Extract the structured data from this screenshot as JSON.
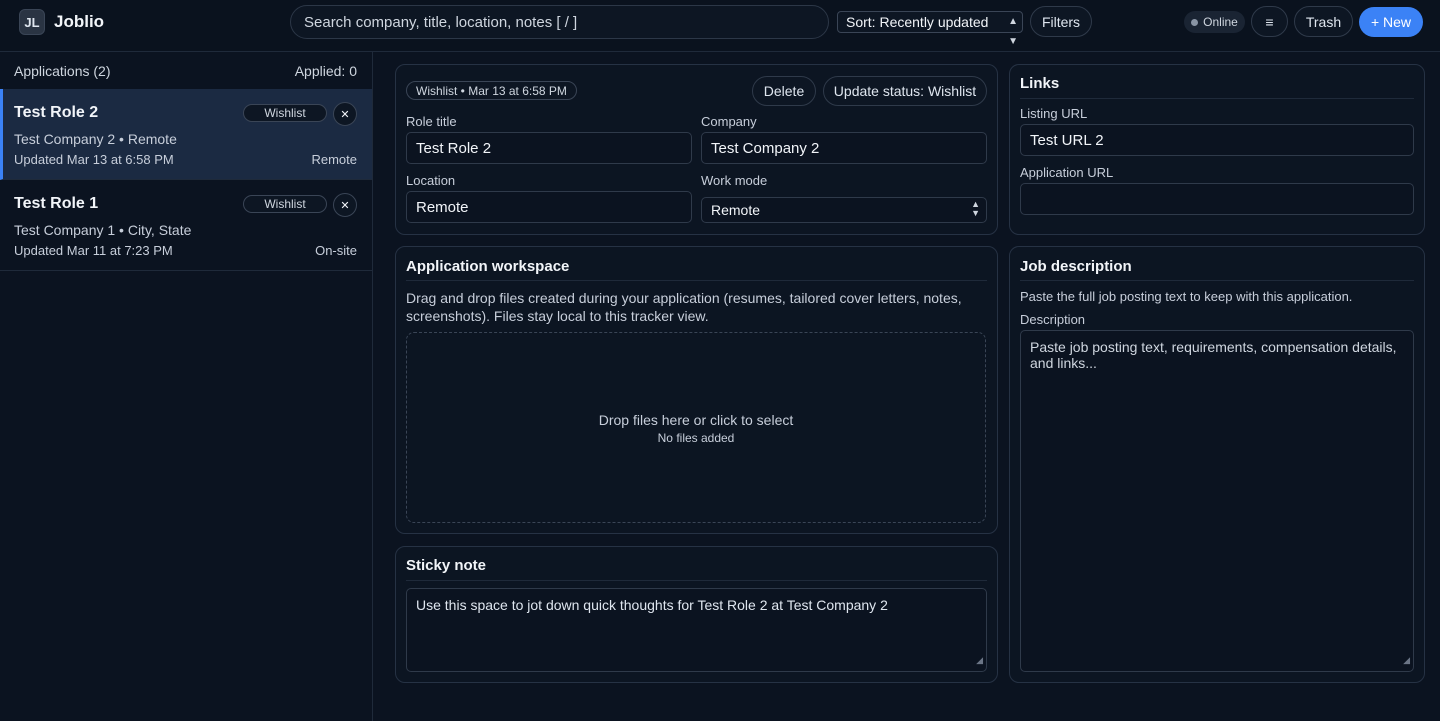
{
  "header": {
    "logo": "JL",
    "title": "Joblio",
    "search_placeholder": "Search company, title, location, notes [ / ]",
    "sort_label": "Sort: Recently updated",
    "filters_label": "Filters",
    "online_label": "Online",
    "menu_icon": "≡",
    "trash_label": "Trash",
    "new_label": "+ New"
  },
  "sidebar": {
    "heading": "Applications (2)",
    "applied": "Applied: 0",
    "items": [
      {
        "title": "Test Role 2",
        "status": "Wishlist",
        "subtitle": "Test Company 2 • Remote",
        "updated": "Updated Mar 13 at 6:58 PM",
        "mode": "Remote",
        "active": true
      },
      {
        "title": "Test Role 1",
        "status": "Wishlist",
        "subtitle": "Test Company 1 • City, State",
        "updated": "Updated Mar 11 at 7:23 PM",
        "mode": "On-site",
        "active": false
      }
    ]
  },
  "details": {
    "status_chip": "Wishlist • Mar 13 at 6:58 PM",
    "delete_label": "Delete",
    "update_status_label": "Update status: Wishlist",
    "role_title_label": "Role title",
    "role_title_value": "Test Role 2",
    "company_label": "Company",
    "company_value": "Test Company 2",
    "location_label": "Location",
    "location_value": "Remote",
    "work_mode_label": "Work mode",
    "work_mode_value": "Remote"
  },
  "links": {
    "title": "Links",
    "listing_label": "Listing URL",
    "listing_value": "Test URL 2",
    "application_label": "Application URL",
    "application_value": ""
  },
  "workspace": {
    "title": "Application workspace",
    "description_line1": "Drag and drop files created during your application (resumes, tailored cover letters, notes,",
    "description_line2": "screenshots). Files stay local to this tracker view.",
    "drop_main": "Drop files here or click to select",
    "drop_sub": "No files added"
  },
  "job_description": {
    "title": "Job description",
    "hint": "Paste the full job posting text to keep with this application.",
    "label": "Description",
    "placeholder": "Paste job posting text, requirements, compensation details, and links..."
  },
  "sticky": {
    "title": "Sticky note",
    "placeholder": "Use this space to jot down quick thoughts for Test Role 2 at Test Company 2"
  }
}
